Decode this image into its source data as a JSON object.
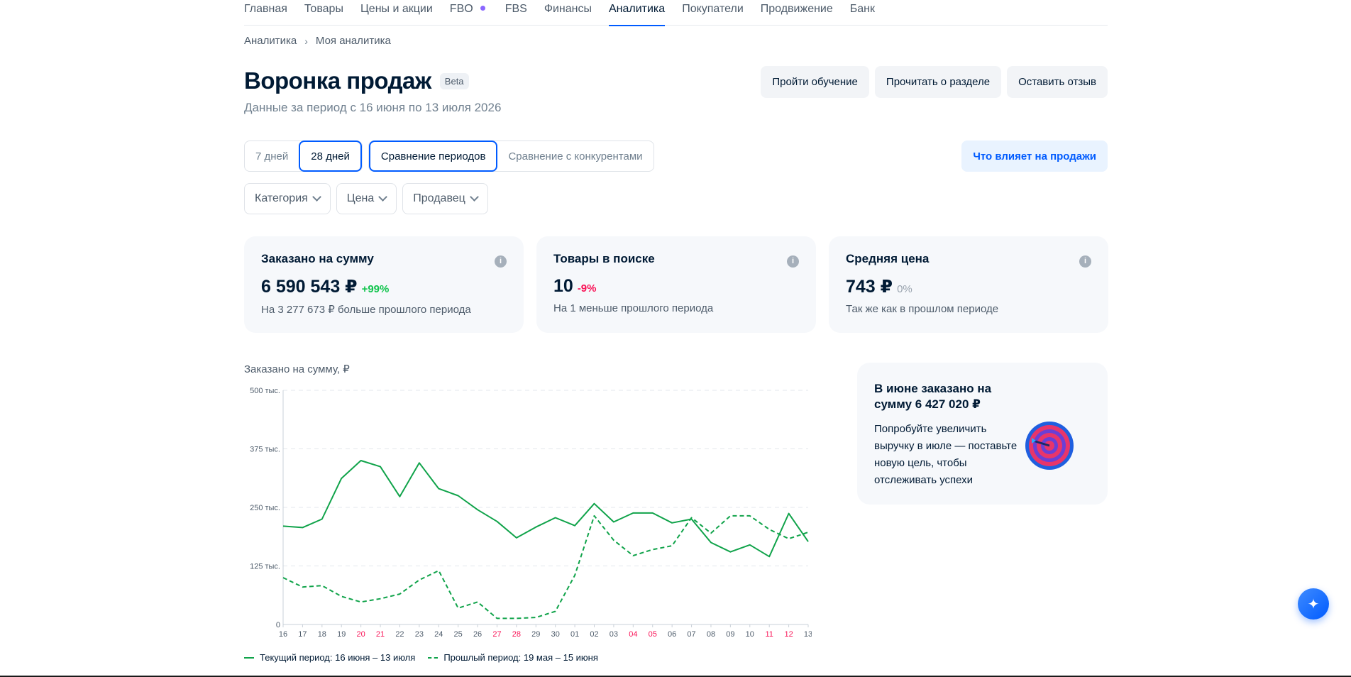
{
  "nav": {
    "items": [
      {
        "label": "Главная"
      },
      {
        "label": "Товары"
      },
      {
        "label": "Цены и акции"
      },
      {
        "label": "FBO"
      },
      {
        "label": "FBS"
      },
      {
        "label": "Финансы"
      },
      {
        "label": "Аналитика"
      },
      {
        "label": "Покупатели"
      },
      {
        "label": "Продвижение"
      },
      {
        "label": "Банк"
      }
    ],
    "active": "Аналитика"
  },
  "breadcrumb": {
    "items": [
      "Аналитика",
      "Моя аналитика"
    ],
    "separator": "›"
  },
  "header": {
    "title": "Воронка продаж",
    "badge": "Beta",
    "subtitle": "Данные за период с 16 июня по 13 июля 2026",
    "buttons": [
      "Пройти обучение",
      "Прочитать о разделе",
      "Оставить отзыв"
    ]
  },
  "period": {
    "options": [
      "7 дней",
      "28 дней"
    ],
    "selected": "28 дней",
    "compare": [
      "Сравнение периодов",
      "Сравнение с конкурентами"
    ],
    "compare_selected": "Сравнение периодов",
    "influence_button": "Что влияет на продажи"
  },
  "filters": [
    "Категория",
    "Цена",
    "Продавец"
  ],
  "cards": [
    {
      "title": "Заказано на сумму",
      "value": "6 590 543 ₽",
      "delta": "+99%",
      "note": "На 3 277 673 ₽ больше прошлого периода"
    },
    {
      "title": "Товары в поиске",
      "value": "10",
      "delta": "-9%",
      "note": "На 1 меньше прошлого периода"
    },
    {
      "title": "Средняя цена",
      "value": "743 ₽",
      "delta": "0%",
      "note": "Так же как в прошлом периоде"
    }
  ],
  "info_icon": "i",
  "promo": {
    "title": "В июне заказано на сумму 6 427 020 ₽",
    "text": "Попробуйте увеличить выручку в июле — поставьте новую цель, чтобы отслеживать успехи"
  },
  "colors": {
    "accent": "#005bff",
    "series": "#10a34a",
    "weekend": "#f91155",
    "up": "#10c44c",
    "down": "#f91155"
  },
  "chart_data": {
    "type": "line",
    "title": "Заказано на сумму, ₽",
    "ylim": [
      0,
      500000
    ],
    "yticks": [
      {
        "value": 0,
        "label": "0"
      },
      {
        "value": 125000,
        "label": "125 тыс."
      },
      {
        "value": 250000,
        "label": "250 тыс."
      },
      {
        "value": 375000,
        "label": "375 тыс."
      },
      {
        "value": 500000,
        "label": "500 тыс."
      }
    ],
    "categories": [
      "16",
      "17",
      "18",
      "19",
      "20",
      "21",
      "22",
      "23",
      "24",
      "25",
      "26",
      "27",
      "28",
      "29",
      "30",
      "01",
      "02",
      "03",
      "04",
      "05",
      "06",
      "07",
      "08",
      "09",
      "10",
      "11",
      "12",
      "13"
    ],
    "weekend": [
      "20",
      "21",
      "27",
      "28",
      "04",
      "05",
      "11",
      "12"
    ],
    "series": [
      {
        "name": "Текущий период: 16 июня – 13 июля",
        "style": "solid",
        "values": [
          210000,
          207000,
          225000,
          312000,
          350000,
          337000,
          273000,
          345000,
          290000,
          275000,
          245000,
          220000,
          185000,
          208000,
          228000,
          211000,
          258000,
          219000,
          238000,
          238000,
          217000,
          225000,
          175000,
          155000,
          170000,
          145000,
          237000,
          177000
        ]
      },
      {
        "name": "Прошлый период: 19 мая – 15 июня",
        "style": "dashed",
        "values": [
          100000,
          80000,
          83000,
          60000,
          48000,
          55000,
          65000,
          95000,
          115000,
          35000,
          48000,
          13000,
          13000,
          15000,
          28000,
          105000,
          232000,
          180000,
          147000,
          160000,
          168000,
          228000,
          195000,
          232000,
          232000,
          203000,
          183000,
          197000
        ]
      }
    ],
    "grid": true,
    "legend": "bottom"
  }
}
